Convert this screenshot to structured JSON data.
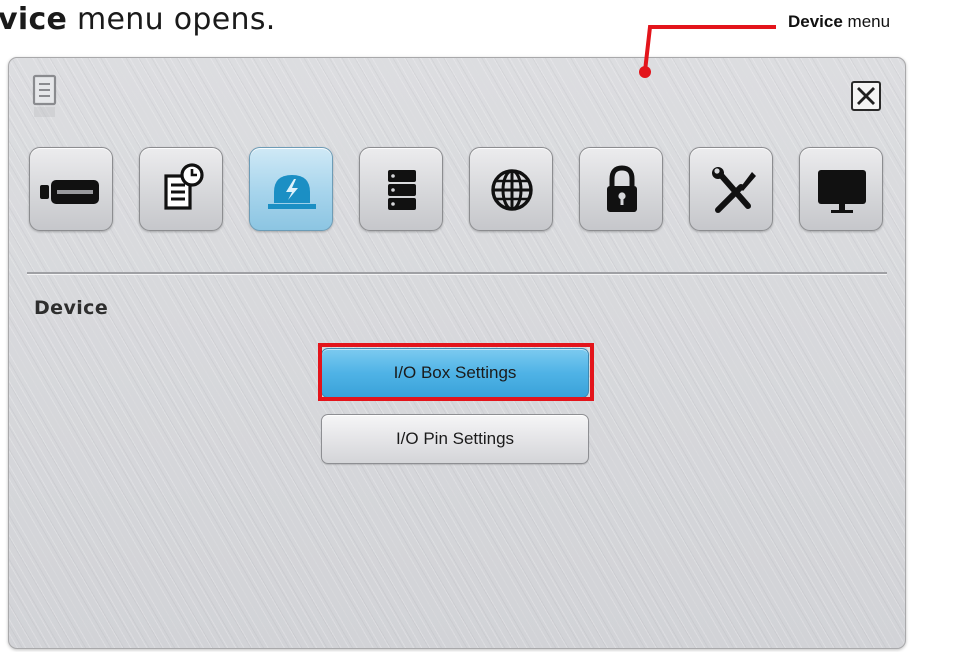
{
  "caption": {
    "bold": "vice",
    "rest": " menu opens."
  },
  "callout": {
    "bold": "Device",
    "rest": " menu",
    "color": "#e3141b"
  },
  "window": {
    "close_label": "Close",
    "tabs": [
      {
        "icon": "camera-icon",
        "active": false
      },
      {
        "icon": "schedule-icon",
        "active": false
      },
      {
        "icon": "alarm-icon",
        "active": true
      },
      {
        "icon": "storage-icon",
        "active": false
      },
      {
        "icon": "network-icon",
        "active": false
      },
      {
        "icon": "lock-icon",
        "active": false
      },
      {
        "icon": "tools-icon",
        "active": false
      },
      {
        "icon": "monitor-icon",
        "active": false
      }
    ],
    "section_title": "Device",
    "buttons": {
      "io_box": "I/O Box Settings",
      "io_pin": "I/O Pin Settings"
    }
  },
  "colors": {
    "accent_blue": "#4fb3e6",
    "highlight_red": "#e3141b",
    "panel_bg": "#d7d8dc"
  }
}
